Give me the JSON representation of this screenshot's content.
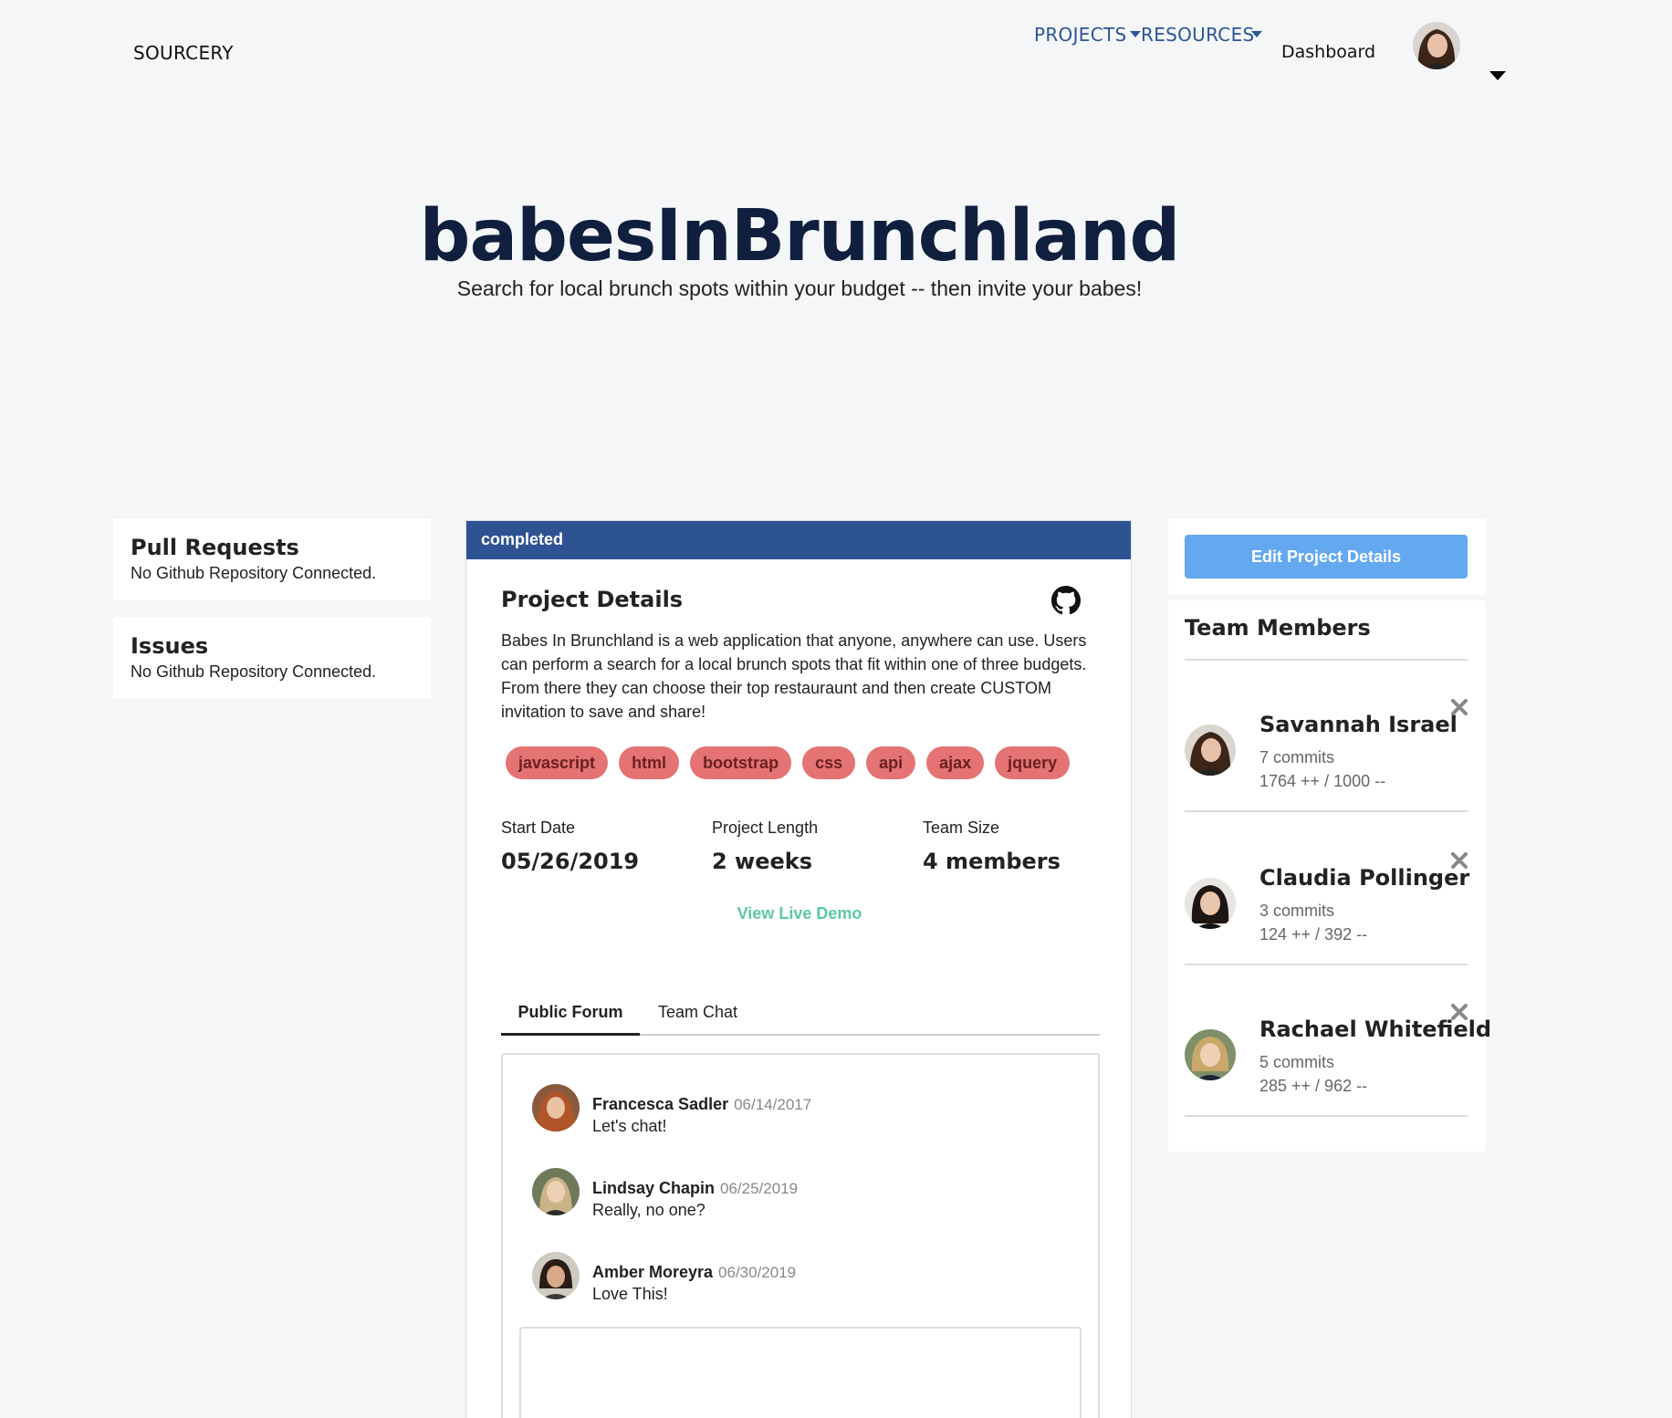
{
  "nav": {
    "brand": "SOURCERY",
    "projects": "PROJECTS",
    "resources": "RESOURCES",
    "dashboard": "Dashboard"
  },
  "hero": {
    "title": "babesInBrunchland",
    "subtitle": "Search for local brunch spots within your budget -- then invite your babes!"
  },
  "left": {
    "pull_requests": {
      "title": "Pull Requests",
      "text": "No Github Repository Connected."
    },
    "issues": {
      "title": "Issues",
      "text": "No Github Repository Connected."
    }
  },
  "project": {
    "status": "completed",
    "details_title": "Project Details",
    "description": "Babes In Brunchland is a web application that anyone, anywhere can use. Users can perform a search for a local brunch spots that fit within one of three budgets. From there they can choose their top restauraunt and then create CUSTOM invitation to save and share!",
    "tags": [
      "javascript",
      "html",
      "bootstrap",
      "css",
      "api",
      "ajax",
      "jquery"
    ],
    "start_date_label": "Start Date",
    "start_date": "05/26/2019",
    "length_label": "Project Length",
    "length": "2 weeks",
    "team_size_label": "Team Size",
    "team_size": "4 members",
    "demo_link": "View Live Demo",
    "tabs": [
      "Public Forum",
      "Team Chat"
    ],
    "messages": [
      {
        "name": "Francesca Sadler",
        "date": "06/14/2017",
        "text": "Let's chat!"
      },
      {
        "name": "Lindsay Chapin",
        "date": "06/25/2019",
        "text": "Really, no one?"
      },
      {
        "name": "Amber Moreyra",
        "date": "06/30/2019",
        "text": "Love This!"
      }
    ]
  },
  "right": {
    "edit_button": "Edit Project Details",
    "team_title": "Team Members",
    "members": [
      {
        "name": "Savannah Israel",
        "commits": "7 commits",
        "lines": "1764 ++ / 1000 --"
      },
      {
        "name": "Claudia Pollinger",
        "commits": "3 commits",
        "lines": "124 ++ / 392 --"
      },
      {
        "name": "Rachael Whitefield",
        "commits": "5 commits",
        "lines": "285 ++ / 962 --"
      }
    ]
  },
  "colors": {
    "status_bar": "#2e5393",
    "tag_bg": "#e57373",
    "demo_link": "#5cc9a7",
    "edit_button": "#64a8f0",
    "nav_link": "#2d5596"
  },
  "icons": [
    "github-icon",
    "close-icon",
    "caret-down-icon"
  ]
}
